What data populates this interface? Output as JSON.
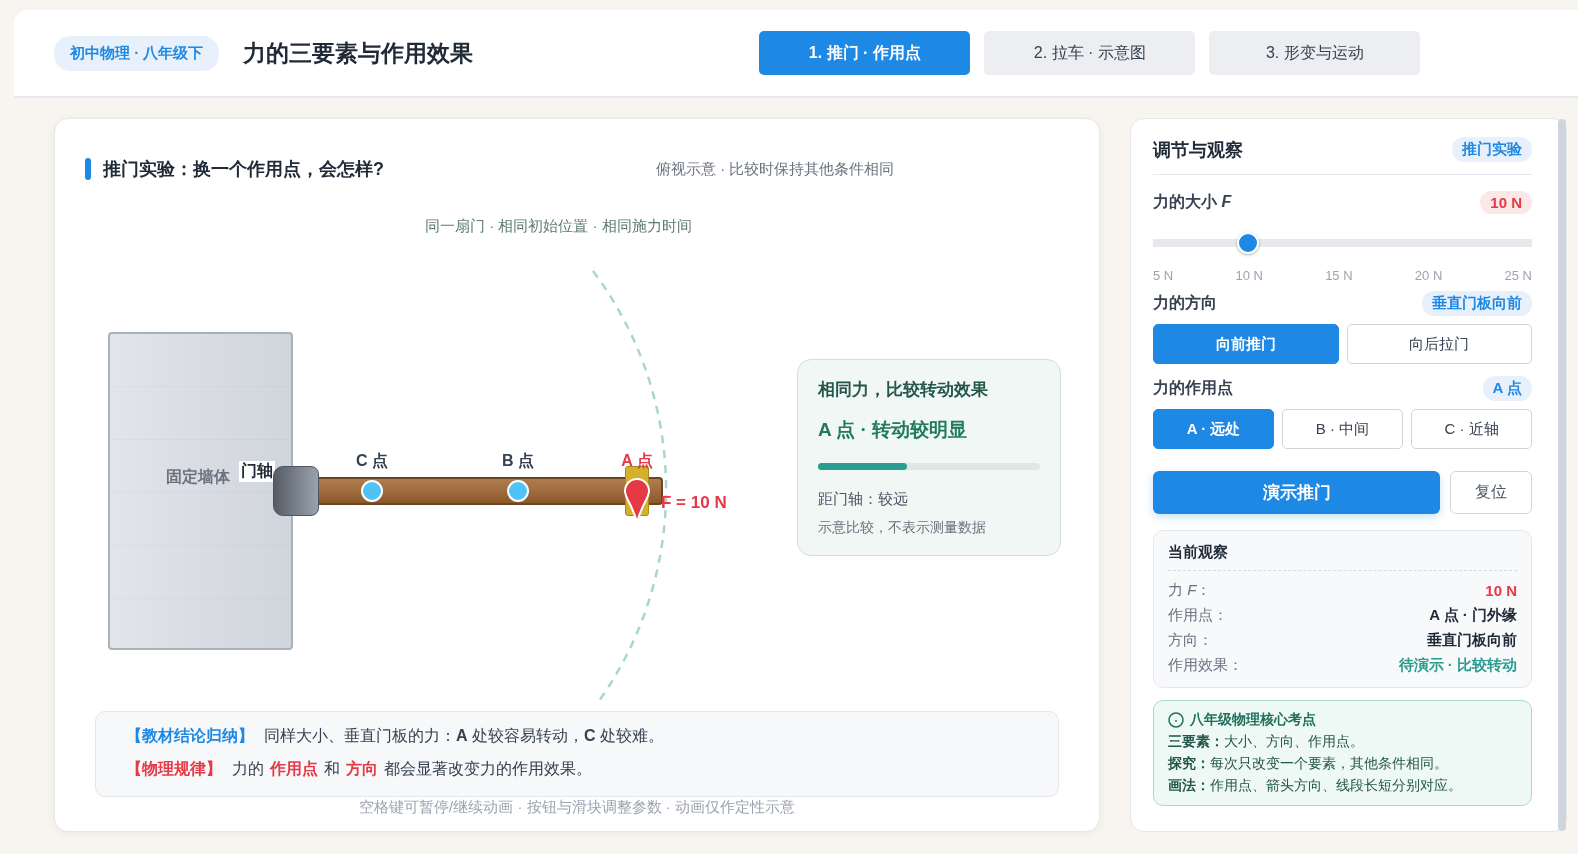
{
  "header": {
    "badge": "初中物理 · 八年级下",
    "title": "力的三要素与作用效果",
    "tabs": [
      {
        "label": "1. 推门 · 作用点",
        "selected": true
      },
      {
        "label": "2. 拉车 · 示意图",
        "selected": false
      },
      {
        "label": "3. 形变与运动",
        "selected": false
      }
    ]
  },
  "experiment": {
    "title": "推门实验：换一个作用点，会怎样?",
    "subtitle": "俯视示意 · 比较时保持其他条件相同",
    "caption": "同一扇门 · 相同初始位置 · 相同施力时间",
    "wall_label": "固定墙体",
    "hinge_label": "门轴",
    "points": [
      {
        "label": "C 点",
        "selected": false
      },
      {
        "label": "B 点",
        "selected": false
      },
      {
        "label": "A 点",
        "selected": true
      }
    ],
    "force_label": "F = 10 N",
    "compare": {
      "title": "相同力，比较转动效果",
      "result": "A 点 · 转动较明显",
      "level": 0.4,
      "distance": "距门轴：较远",
      "note": "示意比较，不表示测量数据"
    },
    "conclusions": [
      {
        "tag": "【教材结论归纳】",
        "kind": "summary",
        "segments": [
          {
            "text": "同样大小、垂直门板的力：**A** 处较容易转动，**C** 处较难。",
            "highlight": false
          }
        ]
      },
      {
        "tag": "【物理规律】",
        "kind": "law",
        "segments": [
          {
            "text": "力的",
            "highlight": false
          },
          {
            "text": "作用点",
            "highlight": true
          },
          {
            "text": "和",
            "highlight": false
          },
          {
            "text": "方向",
            "highlight": true
          },
          {
            "text": "都会显著改变力的作用效果。",
            "highlight": false
          }
        ]
      }
    ],
    "hint": "空格键可暂停/继续动画 · 按钮与滑块调整参数 · 动画仅作定性示意"
  },
  "controls": {
    "title": "调节与观察",
    "badge": "推门实验",
    "magnitude": {
      "label": "力的大小 *F*",
      "value": "10 N",
      "level": 0.25,
      "ticks": [
        "5 N",
        "10 N",
        "15 N",
        "20 N",
        "25 N"
      ]
    },
    "direction": {
      "label": "力的方向",
      "value": "垂直门板向前",
      "options": [
        {
          "label": "向前推门",
          "selected": true
        },
        {
          "label": "向后拉门",
          "selected": false
        }
      ]
    },
    "point": {
      "label": "力的作用点",
      "value": "A 点",
      "options": [
        {
          "label": "A · 远处",
          "selected": true
        },
        {
          "label": "B · 中间",
          "selected": false
        },
        {
          "label": "C · 近轴",
          "selected": false
        }
      ]
    },
    "actions": {
      "primary": "演示推门",
      "secondary": "复位"
    },
    "observation": {
      "title": "当前观察",
      "rows": [
        {
          "label": "力 *F*：",
          "value": "10 N",
          "color": "#e53945"
        },
        {
          "label": "作用点：",
          "value": "A 点 · 门外缘",
          "color": "#1f2937"
        },
        {
          "label": "方向：",
          "value": "垂直门板向前",
          "color": "#1f2937"
        },
        {
          "label": "作用效果：",
          "value": "待演示 · 比较转动",
          "color": "#2a9d8f"
        }
      ]
    },
    "keypoints": {
      "title": "八年级物理核心考点",
      "items": [
        {
          "term": "三要素：",
          "text": "大小、方向、作用点。"
        },
        {
          "term": "探究：",
          "text": "每次只改变一个要素，其他条件相同。"
        },
        {
          "term": "画法：",
          "text": "作用点、箭头方向、线段长短分别对应。"
        }
      ]
    }
  }
}
